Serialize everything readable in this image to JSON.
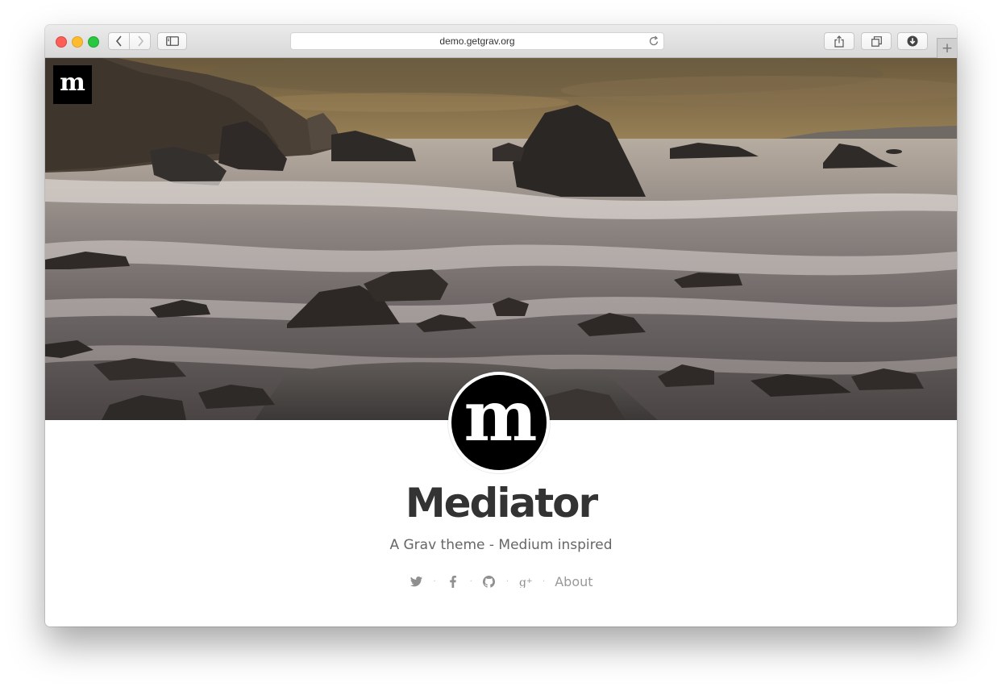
{
  "browser": {
    "url": "demo.getgrav.org",
    "new_tab_label": "+"
  },
  "site": {
    "logo_letter": "m",
    "avatar_letter": "m",
    "title": "Mediator",
    "subtitle": "A Grav theme - Medium inspired"
  },
  "social": {
    "icons": [
      "twitter-icon",
      "facebook-icon",
      "github-icon",
      "google-plus-icon"
    ],
    "separator": "·",
    "about_label": "About"
  },
  "colors": {
    "title": "#333333",
    "subtitle": "#666666",
    "social": "#999999"
  }
}
